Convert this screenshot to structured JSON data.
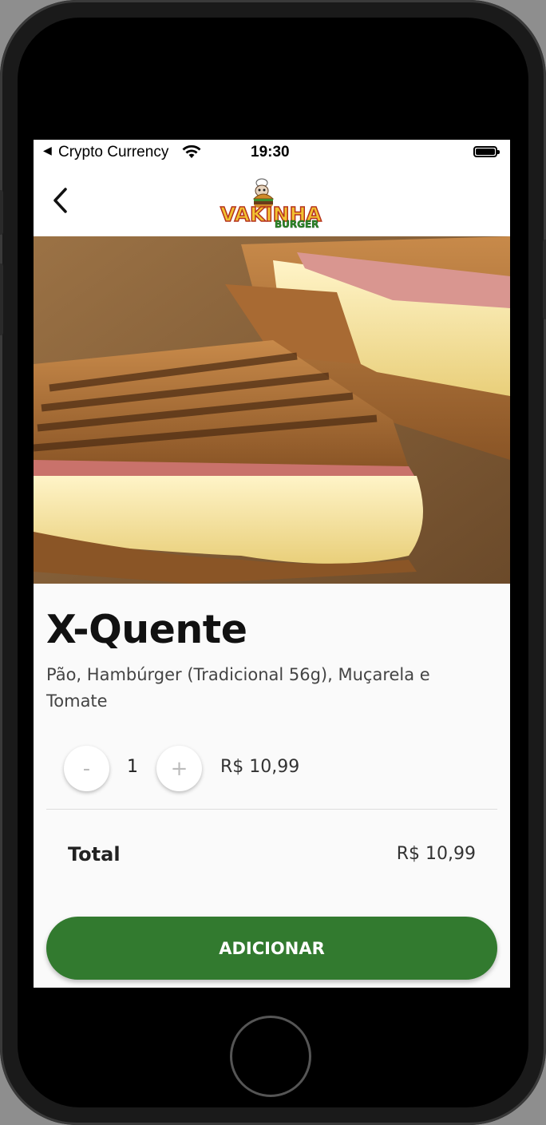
{
  "status_bar": {
    "back_glyph": "◀",
    "carrier": "Crypto Currency",
    "time": "19:30"
  },
  "header": {
    "back_icon": "chevron-left-icon",
    "logo_text_top": "VAKINHA",
    "logo_text_bottom": "BURGER"
  },
  "product": {
    "name": "X-Quente",
    "description": "Pão, Hambúrger (Tradicional 56g), Muçarela e Tomate",
    "image": "grilled-ham-cheese-sandwich"
  },
  "quantity": {
    "minus_label": "-",
    "value": "1",
    "plus_label": "+",
    "unit_price": "R$ 10,99"
  },
  "total": {
    "label": "Total",
    "value": "R$ 10,99"
  },
  "actions": {
    "add_label": "ADICIONAR"
  },
  "colors": {
    "primary": "#327a2f",
    "background": "#fafafa"
  }
}
